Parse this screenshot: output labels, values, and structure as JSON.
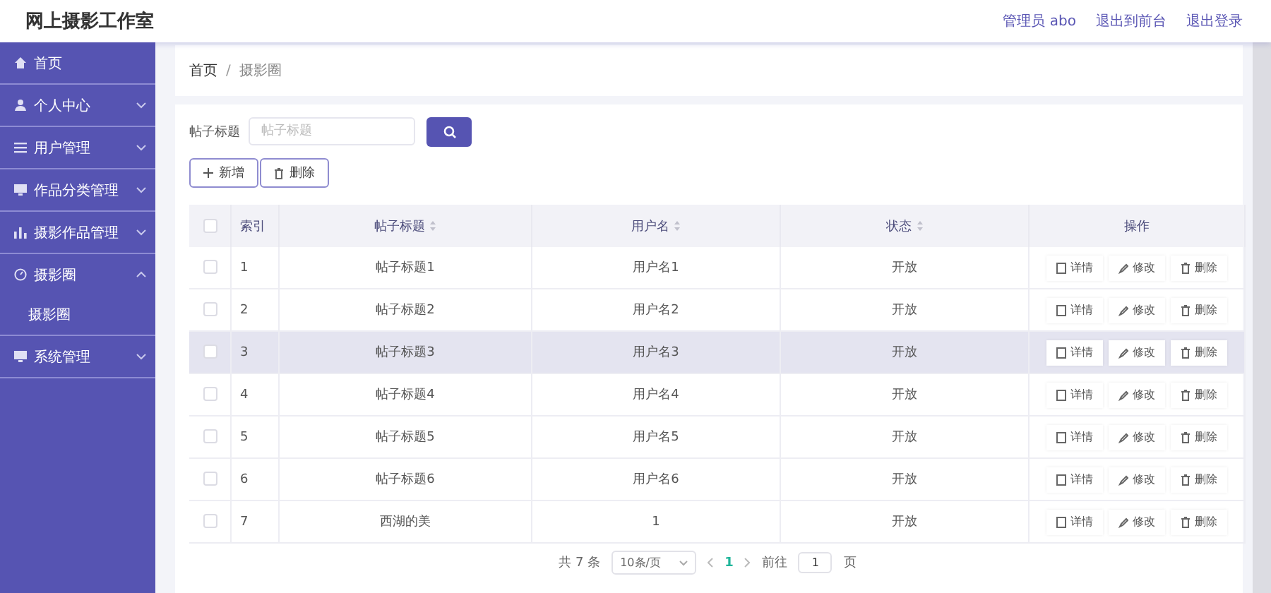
{
  "header": {
    "title": "网上摄影工作室",
    "links": [
      {
        "label": "管理员 abo"
      },
      {
        "label": "退出到前台"
      },
      {
        "label": "退出登录"
      }
    ]
  },
  "sidebar": {
    "items": [
      {
        "label": "首页"
      },
      {
        "label": "个人中心",
        "expanded": false
      },
      {
        "label": "用户管理",
        "expanded": false
      },
      {
        "label": "作品分类管理",
        "expanded": false
      },
      {
        "label": "摄影作品管理",
        "expanded": false
      },
      {
        "label": "摄影圈",
        "expanded": true,
        "children": [
          {
            "label": "摄影圈"
          }
        ]
      },
      {
        "label": "系统管理",
        "expanded": false
      }
    ]
  },
  "breadcrumb": {
    "items": [
      "首页",
      "摄影圈"
    ],
    "separator": "/"
  },
  "search": {
    "label": "帖子标题",
    "placeholder": "帖子标题"
  },
  "toolbar": [
    {
      "label": "新增",
      "kind": "add"
    },
    {
      "label": "删除",
      "kind": "delete"
    }
  ],
  "table": {
    "select_all_checked": false,
    "columns": [
      {
        "label": "索引",
        "sortable": false
      },
      {
        "label": "帖子标题",
        "sortable": true
      },
      {
        "label": "用户名",
        "sortable": true
      },
      {
        "label": "状态",
        "sortable": true
      },
      {
        "label": "操作",
        "sortable": false
      }
    ],
    "rows": [
      {
        "index": "1",
        "title": "帖子标题1",
        "user": "用户名1",
        "status": "开放",
        "hovered": false,
        "checked": false,
        "actions": [
          "详情",
          "修改",
          "删除"
        ]
      },
      {
        "index": "2",
        "title": "帖子标题2",
        "user": "用户名2",
        "status": "开放",
        "hovered": false,
        "checked": false,
        "actions": [
          "详情",
          "修改",
          "删除"
        ]
      },
      {
        "index": "3",
        "title": "帖子标题3",
        "user": "用户名3",
        "status": "开放",
        "hovered": true,
        "checked": false,
        "actions": [
          "详情",
          "修改",
          "删除"
        ]
      },
      {
        "index": "4",
        "title": "帖子标题4",
        "user": "用户名4",
        "status": "开放",
        "hovered": false,
        "checked": false,
        "actions": [
          "详情",
          "修改",
          "删除"
        ]
      },
      {
        "index": "5",
        "title": "帖子标题5",
        "user": "用户名5",
        "status": "开放",
        "hovered": false,
        "checked": false,
        "actions": [
          "详情",
          "修改",
          "删除"
        ]
      },
      {
        "index": "6",
        "title": "帖子标题6",
        "user": "用户名6",
        "status": "开放",
        "hovered": false,
        "checked": false,
        "actions": [
          "详情",
          "修改",
          "删除"
        ]
      },
      {
        "index": "7",
        "title": "西湖的美",
        "user": "1",
        "status": "开放",
        "hovered": false,
        "checked": false,
        "actions": [
          "详情",
          "修改",
          "删除"
        ]
      }
    ]
  },
  "pagination": {
    "total": "共 7 条",
    "page_size": "10条/页",
    "pages": [
      {
        "label": "1",
        "selected": true
      }
    ],
    "goto_label": "前往",
    "goto_value": "1",
    "goto_suffix": "页"
  }
}
